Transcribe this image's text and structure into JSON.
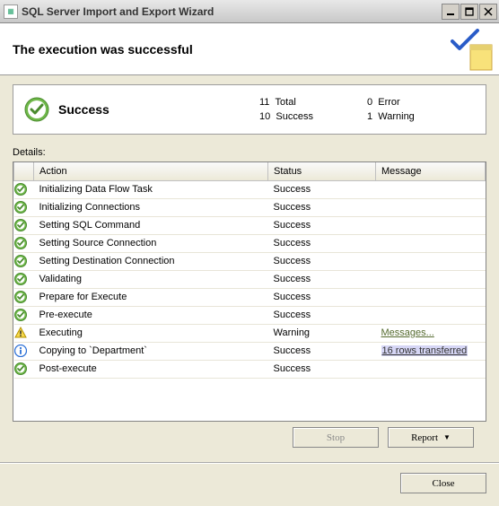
{
  "window": {
    "title": "SQL Server Import and Export Wizard"
  },
  "header": {
    "title": "The execution was successful"
  },
  "summary": {
    "label": "Success",
    "total_count": "11",
    "total_label": "Total",
    "success_count": "10",
    "success_label": "Success",
    "error_count": "0",
    "error_label": "Error",
    "warning_count": "1",
    "warning_label": "Warning"
  },
  "details": {
    "label": "Details:",
    "columns": {
      "action": "Action",
      "status": "Status",
      "message": "Message"
    },
    "rows": [
      {
        "icon": "success",
        "action": "Initializing Data Flow Task",
        "status": "Success",
        "message": "",
        "msgtype": ""
      },
      {
        "icon": "success",
        "action": "Initializing Connections",
        "status": "Success",
        "message": "",
        "msgtype": ""
      },
      {
        "icon": "success",
        "action": "Setting SQL Command",
        "status": "Success",
        "message": "",
        "msgtype": ""
      },
      {
        "icon": "success",
        "action": "Setting Source Connection",
        "status": "Success",
        "message": "",
        "msgtype": ""
      },
      {
        "icon": "success",
        "action": "Setting Destination Connection",
        "status": "Success",
        "message": "",
        "msgtype": ""
      },
      {
        "icon": "success",
        "action": "Validating",
        "status": "Success",
        "message": "",
        "msgtype": ""
      },
      {
        "icon": "success",
        "action": "Prepare for Execute",
        "status": "Success",
        "message": "",
        "msgtype": ""
      },
      {
        "icon": "success",
        "action": "Pre-execute",
        "status": "Success",
        "message": "",
        "msgtype": ""
      },
      {
        "icon": "warning",
        "action": "Executing",
        "status": "Warning",
        "message": "Messages...",
        "msgtype": "link"
      },
      {
        "icon": "info",
        "action": "Copying to `Department`",
        "status": "Success",
        "message": "16 rows transferred",
        "msgtype": "selected"
      },
      {
        "icon": "success",
        "action": "Post-execute",
        "status": "Success",
        "message": "",
        "msgtype": ""
      }
    ]
  },
  "buttons": {
    "stop": "Stop",
    "report": "Report",
    "close": "Close"
  }
}
